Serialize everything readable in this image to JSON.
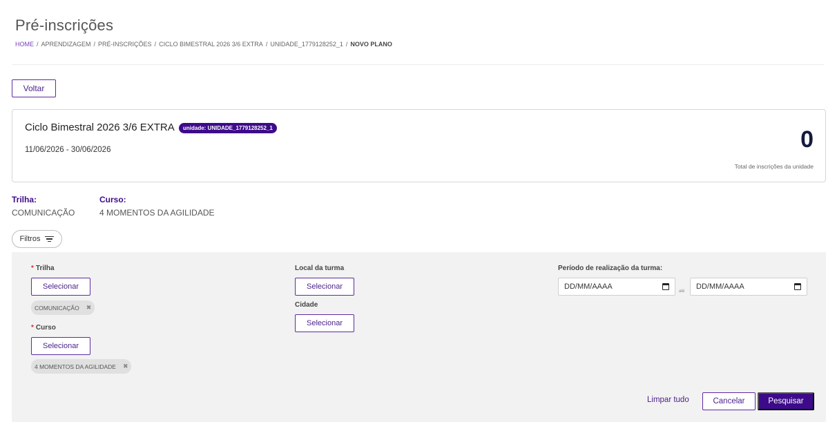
{
  "page": {
    "title": "Pré-inscrições"
  },
  "breadcrumb": [
    {
      "label": "HOME"
    },
    {
      "label": "APRENDIZAGEM"
    },
    {
      "label": "PRÉ-INSCRIÇÕES"
    },
    {
      "label": "CICLO BIMESTRAL 2026 3/6 EXTRA"
    },
    {
      "label": "UNIDADE_1779128252_1"
    },
    {
      "label": "NOVO PLANO"
    }
  ],
  "back_button": {
    "label": "Voltar"
  },
  "cycle": {
    "title": "Ciclo Bimestral 2026 3/6 EXTRA",
    "unit_badge": "unidade: UNIDADE_1779128252_1",
    "dates": "11/06/2026 - 30/06/2026",
    "total_count": "0",
    "total_label": "Total de inscrições da unidade"
  },
  "info": {
    "trilha_label": "Trilha:",
    "trilha_value": "COMUNICAÇÃO",
    "curso_label": "Curso:",
    "curso_value": "4 MOMENTOS DA AGILIDADE"
  },
  "filters": {
    "toggle_label": "Filtros",
    "trilha": {
      "label": "Trilha",
      "button": "Selecionar",
      "chip": "COMUNICAÇÃO"
    },
    "curso": {
      "label": "Curso",
      "button": "Selecionar",
      "chip": "4 MOMENTOS DA AGILIDADE"
    },
    "local": {
      "label": "Local da turma",
      "button": "Selecionar"
    },
    "cidade": {
      "label": "Cidade",
      "button": "Selecionar"
    },
    "periodo": {
      "label": "Período de realização da turma:",
      "start_placeholder": "DD/MM/AAAA",
      "separator": "até",
      "end_placeholder": "DD/MM/AAAA"
    },
    "actions": {
      "clear": "Limpar tudo",
      "cancel": "Cancelar",
      "search": "Pesquisar"
    }
  },
  "colors": {
    "accent": "#3d0b8a",
    "accent_border": "#5b2aa0",
    "panel_bg": "#f2f2f2",
    "required": "#d32f2f"
  }
}
